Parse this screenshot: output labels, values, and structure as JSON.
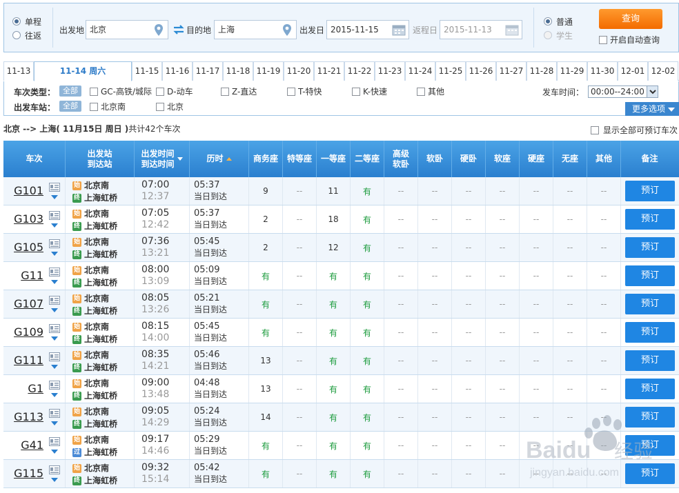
{
  "search": {
    "trip_types": [
      {
        "label": "单程",
        "selected": true
      },
      {
        "label": "往返",
        "selected": false
      }
    ],
    "from_label": "出发地",
    "from_value": "北京",
    "to_label": "目的地",
    "to_value": "上海",
    "depart_label": "出发日",
    "depart_value": "2015-11-15",
    "return_label": "返程日",
    "return_value": "2015-11-13",
    "passenger_types": [
      {
        "label": "普通",
        "selected": true
      },
      {
        "label": "学生",
        "selected": false,
        "disabled": true
      }
    ],
    "query_button": "查询",
    "auto_query_label": "开启自动查询"
  },
  "date_tabs": [
    "11-13",
    "11-14 周六",
    "11-15",
    "11-16",
    "11-17",
    "11-18",
    "11-19",
    "11-20",
    "11-21",
    "11-22",
    "11-23",
    "11-24",
    "11-25",
    "11-26",
    "11-27",
    "11-28",
    "11-29",
    "11-30",
    "12-01",
    "12-02"
  ],
  "active_tab_index": 1,
  "filters": {
    "type_label": "车次类型：",
    "all_label": "全部",
    "types": [
      "GC-高铁/城际",
      "D-动车",
      "Z-直达",
      "T-特快",
      "K-快速",
      "其他"
    ],
    "station_label": "出发车站：",
    "stations": [
      "北京南",
      "北京"
    ],
    "time_label": "发车时间：",
    "time_value": "00:00--24:00",
    "more_options": "更多选项"
  },
  "summary": {
    "route": "北京 --> 上海",
    "date": "( 11月15日  周日 )",
    "count": "共计42个车次",
    "show_all_label": "显示全部可预订车次"
  },
  "table": {
    "headers": {
      "train": "车次",
      "station1": "出发站",
      "station2": "到达站",
      "time1": "出发时间",
      "time2": "到达时间",
      "duration": "历时",
      "seats": [
        "商务座",
        "特等座",
        "一等座",
        "二等座",
        "高级\n软卧",
        "软卧",
        "硬卧",
        "软座",
        "硬座",
        "无座",
        "其他"
      ],
      "remark": "备注"
    },
    "rows": [
      {
        "no": "G101",
        "from": "北京南",
        "to": "上海虹桥",
        "to_type": "终",
        "dep": "07:00",
        "arr": "12:37",
        "dur": "05:37",
        "arrive": "当日到达",
        "seats": [
          "9",
          "--",
          "11",
          "有",
          "--",
          "--",
          "--",
          "--",
          "--",
          "--",
          "--"
        ]
      },
      {
        "no": "G103",
        "from": "北京南",
        "to": "上海虹桥",
        "to_type": "终",
        "dep": "07:05",
        "arr": "12:42",
        "dur": "05:37",
        "arrive": "当日到达",
        "seats": [
          "2",
          "--",
          "18",
          "有",
          "--",
          "--",
          "--",
          "--",
          "--",
          "--",
          "--"
        ]
      },
      {
        "no": "G105",
        "from": "北京南",
        "to": "上海虹桥",
        "to_type": "终",
        "dep": "07:36",
        "arr": "13:21",
        "dur": "05:45",
        "arrive": "当日到达",
        "seats": [
          "2",
          "--",
          "12",
          "有",
          "--",
          "--",
          "--",
          "--",
          "--",
          "--",
          "--"
        ]
      },
      {
        "no": "G11",
        "from": "北京南",
        "to": "上海虹桥",
        "to_type": "终",
        "dep": "08:00",
        "arr": "13:09",
        "dur": "05:09",
        "arrive": "当日到达",
        "seats": [
          "有",
          "--",
          "有",
          "有",
          "--",
          "--",
          "--",
          "--",
          "--",
          "--",
          "--"
        ]
      },
      {
        "no": "G107",
        "from": "北京南",
        "to": "上海虹桥",
        "to_type": "终",
        "dep": "08:05",
        "arr": "13:26",
        "dur": "05:21",
        "arrive": "当日到达",
        "seats": [
          "有",
          "--",
          "有",
          "有",
          "--",
          "--",
          "--",
          "--",
          "--",
          "--",
          "--"
        ]
      },
      {
        "no": "G109",
        "from": "北京南",
        "to": "上海虹桥",
        "to_type": "终",
        "dep": "08:15",
        "arr": "14:00",
        "dur": "05:45",
        "arrive": "当日到达",
        "seats": [
          "有",
          "--",
          "有",
          "有",
          "--",
          "--",
          "--",
          "--",
          "--",
          "--",
          "--"
        ]
      },
      {
        "no": "G111",
        "from": "北京南",
        "to": "上海虹桥",
        "to_type": "终",
        "dep": "08:35",
        "arr": "14:21",
        "dur": "05:46",
        "arrive": "当日到达",
        "seats": [
          "13",
          "--",
          "有",
          "有",
          "--",
          "--",
          "--",
          "--",
          "--",
          "--",
          "--"
        ]
      },
      {
        "no": "G1",
        "from": "北京南",
        "to": "上海虹桥",
        "to_type": "终",
        "dep": "09:00",
        "arr": "13:48",
        "dur": "04:48",
        "arrive": "当日到达",
        "seats": [
          "13",
          "--",
          "有",
          "有",
          "--",
          "--",
          "--",
          "--",
          "--",
          "--",
          "--"
        ]
      },
      {
        "no": "G113",
        "from": "北京南",
        "to": "上海虹桥",
        "to_type": "终",
        "dep": "09:05",
        "arr": "14:29",
        "dur": "05:24",
        "arrive": "当日到达",
        "seats": [
          "14",
          "--",
          "有",
          "有",
          "--",
          "--",
          "--",
          "--",
          "--",
          "--",
          "--"
        ]
      },
      {
        "no": "G41",
        "from": "北京南",
        "to": "上海虹桥",
        "to_type": "过",
        "dep": "09:17",
        "arr": "14:46",
        "dur": "05:29",
        "arrive": "当日到达",
        "seats": [
          "有",
          "--",
          "有",
          "有",
          "--",
          "--",
          "--",
          "--",
          "--",
          "--",
          "--"
        ]
      },
      {
        "no": "G115",
        "from": "北京南",
        "to": "上海虹桥",
        "to_type": "终",
        "dep": "09:32",
        "arr": "15:14",
        "dur": "05:42",
        "arrive": "当日到达",
        "seats": [
          "有",
          "--",
          "有",
          "有",
          "--",
          "--",
          "--",
          "--",
          "--",
          "--",
          "--"
        ]
      }
    ],
    "start_badge": "始",
    "book_label": "预订"
  },
  "watermark": {
    "brand": "Baidu",
    "brand_cn": "经验",
    "url": "jingyan.baidu.com"
  },
  "colors": {
    "accent": "#2a7fcf",
    "query": "#f36b00",
    "available": "#1b9b3c",
    "book": "#1f86e3"
  }
}
